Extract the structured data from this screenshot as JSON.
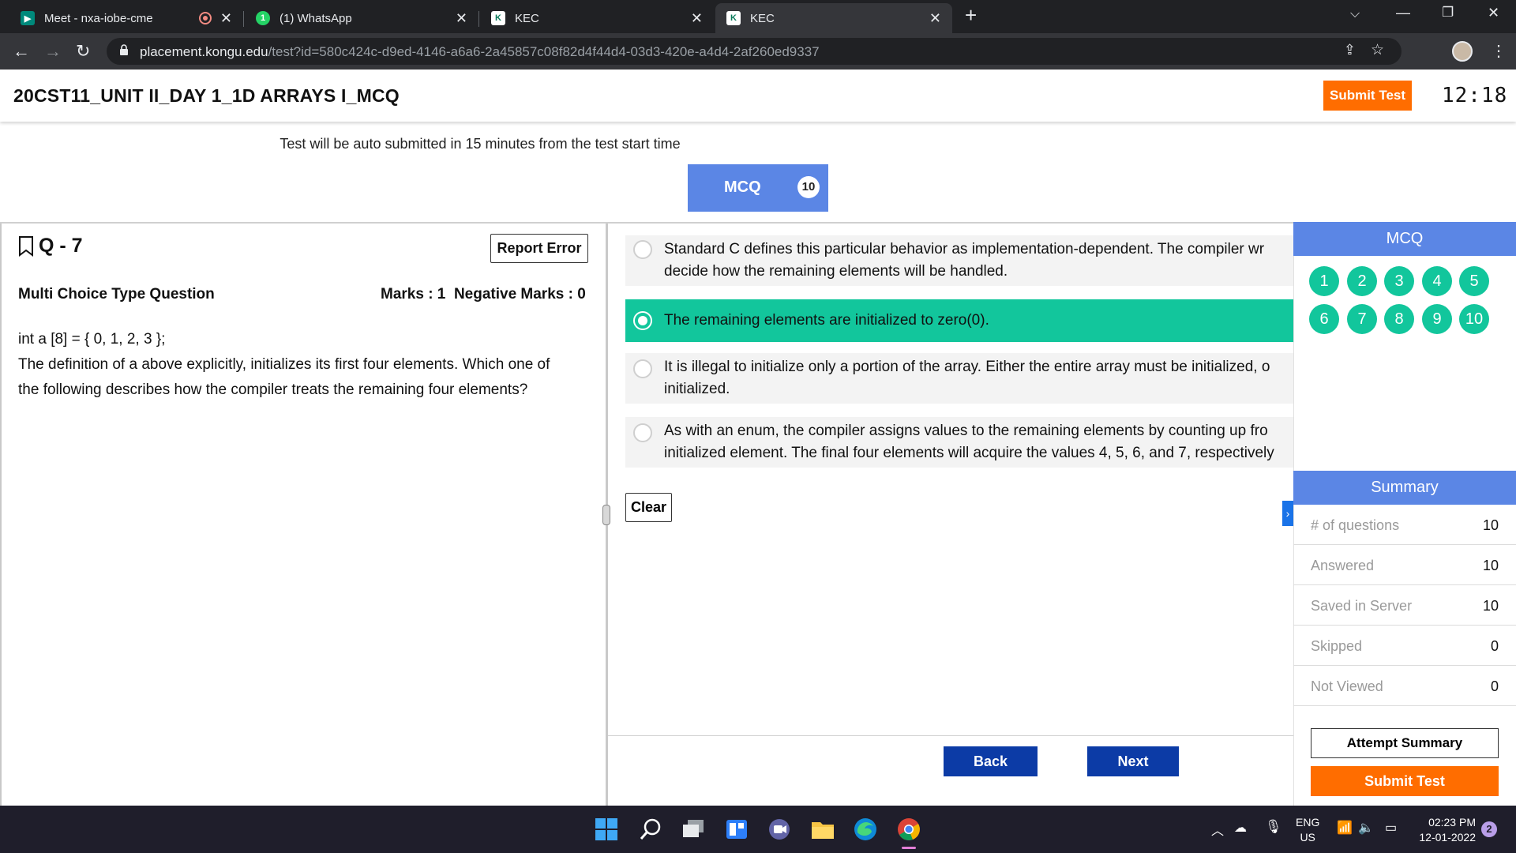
{
  "browser": {
    "tabs": [
      {
        "title": "Meet - nxa-iobe-cme"
      },
      {
        "title": "(1) WhatsApp"
      },
      {
        "title": "KEC"
      },
      {
        "title": "KEC"
      }
    ],
    "url_host": "placement.kongu.edu",
    "url_rest": "/test?id=580c424c-d9ed-4146-a6a6-2a45857c08f82d4f44d4-03d3-420e-a4d4-2af260ed9337"
  },
  "header": {
    "title": "20CST11_UNIT II_DAY 1_1D ARRAYS I_MCQ",
    "submit_label": "Submit Test",
    "timer": "12:18"
  },
  "notice": "Test will be auto submitted in 15 minutes from the test start time",
  "section_tab": {
    "label": "MCQ",
    "count": "10"
  },
  "question": {
    "number_label": "Q - 7",
    "report_label": "Report Error",
    "type_label": "Multi Choice Type Question",
    "marks_label": "Marks : 1",
    "negative_label": "Negative Marks : 0",
    "code_line": "int a [8] = { 0, 1, 2, 3 };",
    "text_line1": "The definition of a above explicitly, initializes its first four elements. Which one of",
    "text_line2": "the following describes how the compiler treats the remaining four elements?"
  },
  "options": [
    {
      "line1": "Standard C defines this particular behavior as implementation-dependent. The compiler wr",
      "line2": "decide how the remaining elements will be handled.",
      "selected": false
    },
    {
      "line1": "The remaining elements are initialized to zero(0).",
      "line2": "",
      "selected": true
    },
    {
      "line1": "It is illegal to initialize only a portion of the array. Either the entire array must be initialized, o",
      "line2": "initialized.",
      "selected": false
    },
    {
      "line1": "As with an enum, the compiler assigns values to the remaining elements by counting up fro",
      "line2": "initialized element. The final four elements will acquire the values 4, 5, 6, and 7, respectively",
      "selected": false
    }
  ],
  "clear_label": "Clear",
  "nav": {
    "back_label": "Back",
    "next_label": "Next"
  },
  "right_panel": {
    "heading": "MCQ",
    "question_numbers": [
      "1",
      "2",
      "3",
      "4",
      "5",
      "6",
      "7",
      "8",
      "9",
      "10"
    ],
    "answered_color": "#12c69c",
    "summary_heading": "Summary",
    "summary": [
      {
        "label": "# of questions",
        "value": "10"
      },
      {
        "label": "Answered",
        "value": "10"
      },
      {
        "label": "Saved in Server",
        "value": "10"
      },
      {
        "label": "Skipped",
        "value": "0"
      },
      {
        "label": "Not Viewed",
        "value": "0"
      }
    ],
    "attempt_label": "Attempt Summary",
    "submit_label": "Submit Test"
  },
  "taskbar": {
    "lang1": "ENG",
    "lang2": "US",
    "time": "02:23 PM",
    "date": "12-01-2022",
    "notification_count": "2"
  },
  "colors": {
    "accent_blue": "#5b86e5",
    "nav_blue": "#0c3ba6",
    "orange": "#ff6d00",
    "green": "#12c69c"
  }
}
